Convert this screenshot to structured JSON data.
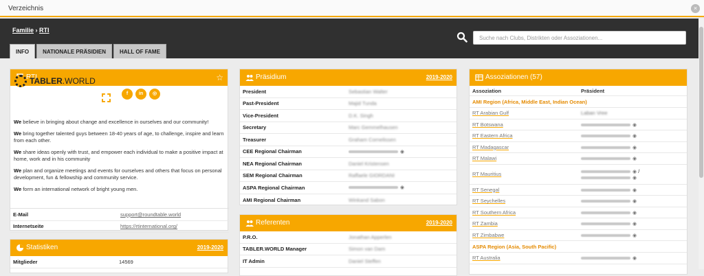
{
  "window": {
    "title": "Verzeichnis",
    "close_icon": "close-icon"
  },
  "breadcrumb": {
    "first": "Familie",
    "sep": "›",
    "second": "RTI"
  },
  "tabs": [
    "INFO",
    "NATIONALE PRÄSIDIEN",
    "HALL OF FAME"
  ],
  "search": {
    "placeholder": "Suche nach Clubs, Distrikten oder Assoziationen..."
  },
  "rti": {
    "title": "RTI",
    "logo_text_bold": "TABLER",
    "logo_text_rest": ".WORLD",
    "social": [
      "f",
      "in",
      "◎"
    ],
    "paragraphs": [
      {
        "lead": "We",
        "text": " believe in bringing about change and excellence in ourselves and our community!"
      },
      {
        "lead": "We",
        "text": " bring together talented guys between 18-40 years of age, to challenge, inspire and learn from each other."
      },
      {
        "lead": "We",
        "text": " share ideas openly with trust, and empower each individual to make a positive impact at home, work and in his community"
      },
      {
        "lead": "We",
        "text": " plan and organize meetings and events for ourselves and others that focus on personal development, fun & fellowship and community service."
      },
      {
        "lead": "We",
        "text": " form an international network of bright young men."
      }
    ],
    "email_label": "E-Mail",
    "email": "support@roundtable.world",
    "web_label": "Internetseite",
    "web": "https://rtinternational.org/"
  },
  "stats": {
    "title": "Statistiken",
    "year": "2019-2020",
    "members_label": "Mitglieder",
    "members": "14569"
  },
  "praesidium": {
    "title": "Präsidium",
    "year": "2019-2020",
    "rows": [
      {
        "role": "President",
        "name": "Sebastian Walter"
      },
      {
        "role": "Past-President",
        "name": "Majid Tunda"
      },
      {
        "role": "Vice-President",
        "name": "D.K. Singh"
      },
      {
        "role": "Secretary",
        "name": "Marc Gemmelhausen"
      },
      {
        "role": "Treasurer",
        "name": "Graham Cornelissen"
      },
      {
        "role": "CEE Regional Chairman",
        "name": ""
      },
      {
        "role": "NEA Regional Chairman",
        "name": "Daniel Kristensen"
      },
      {
        "role": "SEM Regional Chairman",
        "name": "Raffaele GIORDANI"
      },
      {
        "role": "ASPA Regional Chairman",
        "name": ""
      },
      {
        "role": "AMI Regional Chairman",
        "name": "Winkand Sabon"
      }
    ]
  },
  "referenten": {
    "title": "Referenten",
    "year": "2019-2020",
    "rows": [
      {
        "role": "P.R.O.",
        "name": "Jonathan Apperlen"
      },
      {
        "role": "TABLER.WORLD Manager",
        "name": "Simon van Dam"
      },
      {
        "role": "IT Admin",
        "name": "Daniel Steffen"
      }
    ]
  },
  "assoc": {
    "title": "Assoziationen (57)",
    "col1": "Assoziation",
    "col2": "Präsident",
    "regions": [
      {
        "name": "AMI Region (Africa, Middle East, Indian Ocean)",
        "items": [
          "RT Arabian Gulf",
          "RT Botswana",
          "RT Eastern Africa",
          "RT Madagascar",
          "RT Malawi",
          "RT Mauritius",
          "RT Senegal",
          "RT Seychelles",
          "RT Southern Africa",
          "RT Zambia",
          "RT Zimbabwe"
        ]
      },
      {
        "name": "ASPA Region (Asia, South Pacific)",
        "items": [
          "RT Australia"
        ]
      }
    ],
    "arabian_gulf_president": "Laban Vree"
  },
  "colors": {
    "accent": "#f7a700",
    "header": "#303030",
    "region": "#e48a00"
  }
}
